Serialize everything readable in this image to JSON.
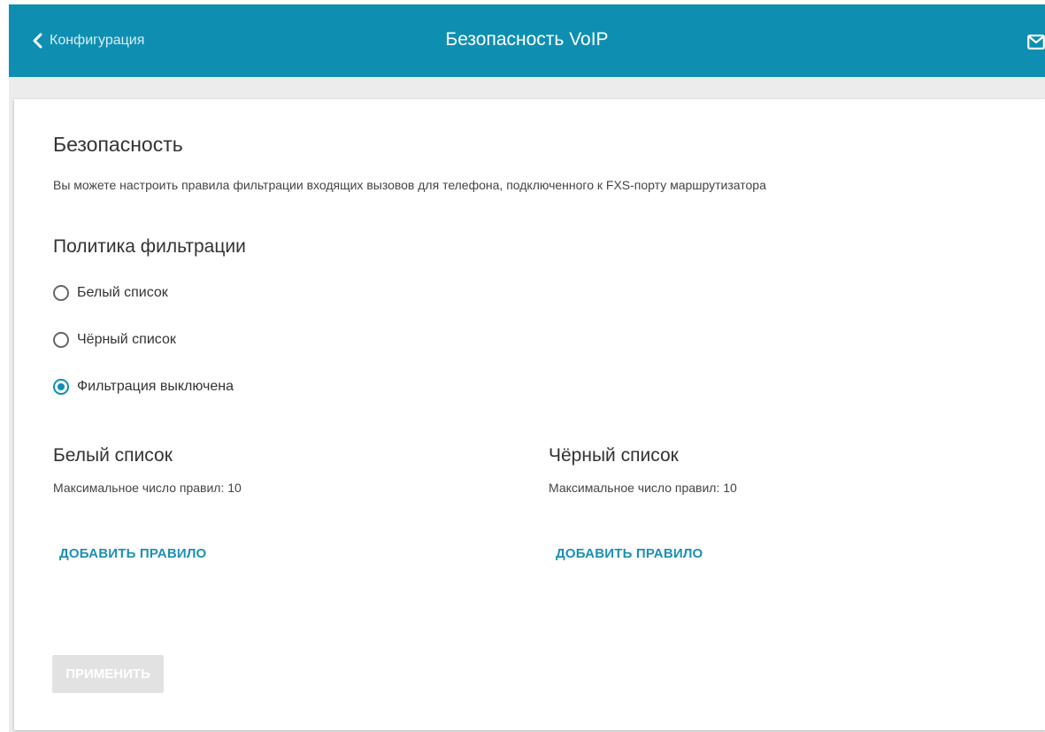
{
  "header": {
    "back_label": "Конфигурация",
    "title": "Безопасность VoIP",
    "back_icon": "chevron-left-icon",
    "mail_icon": "mail-icon",
    "color": "#0e8fb1"
  },
  "security": {
    "title": "Безопасность",
    "description": "Вы можете настроить правила фильтрации входящих вызовов для телефона, подключенного к FXS-порту маршрутизатора"
  },
  "policy": {
    "title": "Политика фильтрации",
    "options": [
      {
        "label": "Белый список",
        "selected": false
      },
      {
        "label": "Чёрный список",
        "selected": false
      },
      {
        "label": "Фильтрация выключена",
        "selected": true
      }
    ]
  },
  "whitelist": {
    "title": "Белый список",
    "max_rules": "Максимальное число правил: 10",
    "add_label": "ДОБАВИТЬ ПРАВИЛО"
  },
  "blacklist": {
    "title": "Чёрный список",
    "max_rules": "Максимальное число правил: 10",
    "add_label": "ДОБАВИТЬ ПРАВИЛО"
  },
  "apply_label": "ПРИМЕНИТЬ"
}
